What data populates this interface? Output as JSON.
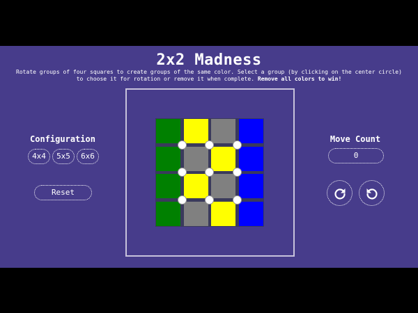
{
  "header": {
    "title": "2x2 Madness",
    "instructions_line1": "Rotate groups of four squares to create groups of the same color. Select a group (by clicking on the center circle)",
    "instructions_line2": "to choose it for rotation or remove it when complete.",
    "instructions_bold": "Remove all colors to win!"
  },
  "config": {
    "heading": "Configuration",
    "options": [
      "4x4",
      "5x5",
      "6x6"
    ]
  },
  "reset": {
    "label": "Reset"
  },
  "moves": {
    "heading": "Move Count",
    "value": "0"
  },
  "controls": {
    "rotate_clockwise_icon": "rotate-clockwise-icon",
    "rotate_counterclockwise_icon": "rotate-counterclockwise-icon"
  },
  "colors": {
    "background": "#473c8b",
    "green": "#008000",
    "yellow": "#ffff00",
    "gray": "#808080",
    "blue": "#0000ff"
  },
  "board": {
    "size": 4,
    "cells": [
      [
        "green",
        "yellow",
        "gray",
        "blue"
      ],
      [
        "green",
        "gray",
        "yellow",
        "blue"
      ],
      [
        "green",
        "yellow",
        "gray",
        "blue"
      ],
      [
        "green",
        "gray",
        "yellow",
        "blue"
      ]
    ]
  }
}
